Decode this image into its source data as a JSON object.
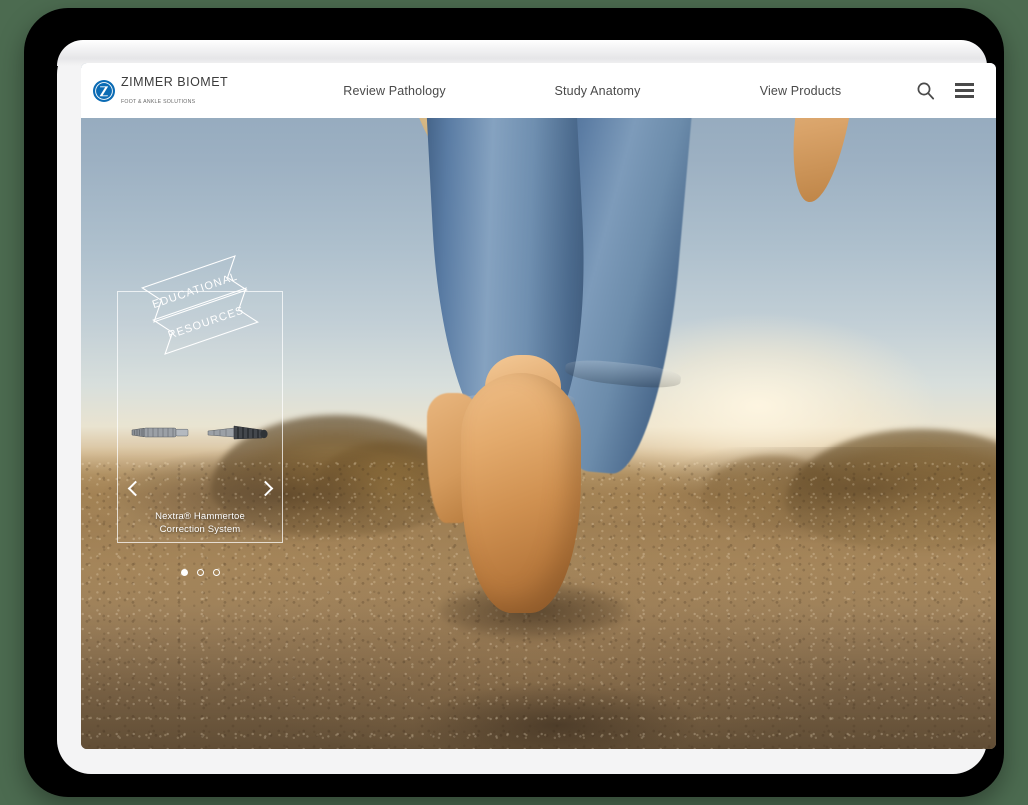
{
  "device": {
    "type": "tablet-mockup",
    "backdrop_color": "#4c6b50",
    "frame_color": "#000000",
    "bezel_color": "#f4f4f5"
  },
  "header": {
    "background": "#ffffff",
    "brand": {
      "mark_color": "#0b6bb4",
      "mark_letter": "Z",
      "name": "ZIMMER BIOMET",
      "tagline": "FOOT & ANKLE SOLUTIONS"
    },
    "nav": [
      {
        "label": "Review Pathology"
      },
      {
        "label": "Study Anatomy"
      },
      {
        "label": "View Products"
      }
    ],
    "actions": [
      {
        "icon": "search-icon",
        "label": "Search"
      },
      {
        "icon": "hamburger-icon",
        "label": "Menu"
      }
    ]
  },
  "hero": {
    "description": "Person walking barefoot on sandy dune at sunset, wearing rolled blue jeans and carrying a striped tote bag",
    "sky_color": "#a9bdcb",
    "sand_color": "#a07c4e"
  },
  "carousel": {
    "ribbon": {
      "line1": "EDUCATIONAL",
      "line2": "RESOURCES"
    },
    "product_image_alt": "Two orthopedic bone screw implants",
    "caption_line1": "Nextra® Hammertoe",
    "caption_line2": "Correction System",
    "prev_label": "Previous slide",
    "next_label": "Next slide",
    "dots": [
      {
        "active": true
      },
      {
        "active": false
      },
      {
        "active": false
      }
    ]
  }
}
